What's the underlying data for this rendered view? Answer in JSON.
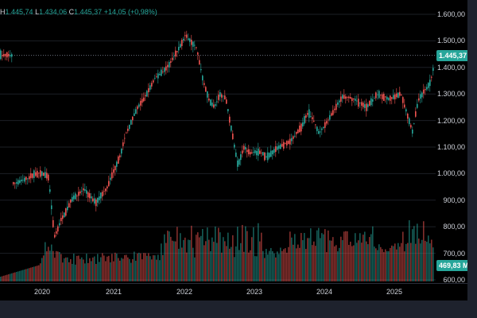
{
  "legend": {
    "high_label": "H",
    "high_value": "1.445,74",
    "low_label": "L",
    "low_value": "1.434,06",
    "close_label": "C",
    "close_value": "1.445,37",
    "change": "+14,05 (+0,98%)"
  },
  "price_axis_labels": [
    "1.600,00",
    "1.500,00",
    "1.400,00",
    "1.300,00",
    "1.200,00",
    "1.100,00",
    "1.000,00",
    "900,00",
    "800,00",
    "700,00",
    "600,00"
  ],
  "time_axis_labels": [
    "2020",
    "2021",
    "2022",
    "2023",
    "2024",
    "2025"
  ],
  "last_price_badge": "1.445,37",
  "volume_badge": "469,83 M",
  "colors": {
    "up": "#26a69a",
    "down": "#ef5350",
    "background": "#000000",
    "grid": "#1c1f26",
    "text": "#d1d4dc",
    "last_price": "#26a69a"
  },
  "price_series": [
    [
      "2019-07",
      960
    ],
    [
      "2019-09",
      975
    ],
    [
      "2019-11",
      1000
    ],
    [
      "2020-01",
      1000
    ],
    [
      "2020-02",
      985
    ],
    [
      "2020-03",
      760
    ],
    [
      "2020-04",
      820
    ],
    [
      "2020-05",
      860
    ],
    [
      "2020-06",
      905
    ],
    [
      "2020-08",
      940
    ],
    [
      "2020-10",
      890
    ],
    [
      "2020-12",
      950
    ],
    [
      "2021-02",
      1070
    ],
    [
      "2021-03",
      1150
    ],
    [
      "2021-05",
      1250
    ],
    [
      "2021-06",
      1280
    ],
    [
      "2021-08",
      1360
    ],
    [
      "2021-10",
      1400
    ],
    [
      "2021-12",
      1470
    ],
    [
      "2022-01",
      1520
    ],
    [
      "2022-02",
      1500
    ],
    [
      "2022-03",
      1470
    ],
    [
      "2022-04",
      1360
    ],
    [
      "2022-05",
      1280
    ],
    [
      "2022-06",
      1250
    ],
    [
      "2022-07",
      1300
    ],
    [
      "2022-08",
      1280
    ],
    [
      "2022-10",
      1030
    ],
    [
      "2022-11",
      1100
    ],
    [
      "2022-12",
      1080
    ],
    [
      "2023-02",
      1080
    ],
    [
      "2023-03",
      1060
    ],
    [
      "2023-05",
      1100
    ],
    [
      "2023-07",
      1120
    ],
    [
      "2023-09",
      1180
    ],
    [
      "2023-10",
      1230
    ],
    [
      "2023-11",
      1200
    ],
    [
      "2023-12",
      1150
    ],
    [
      "2024-02",
      1220
    ],
    [
      "2024-04",
      1290
    ],
    [
      "2024-06",
      1280
    ],
    [
      "2024-08",
      1250
    ],
    [
      "2024-10",
      1300
    ],
    [
      "2024-12",
      1280
    ],
    [
      "2025-02",
      1300
    ],
    [
      "2025-04",
      1160
    ],
    [
      "2025-05",
      1280
    ],
    [
      "2025-07",
      1340
    ],
    [
      "2025-08",
      1445.37
    ]
  ]
}
